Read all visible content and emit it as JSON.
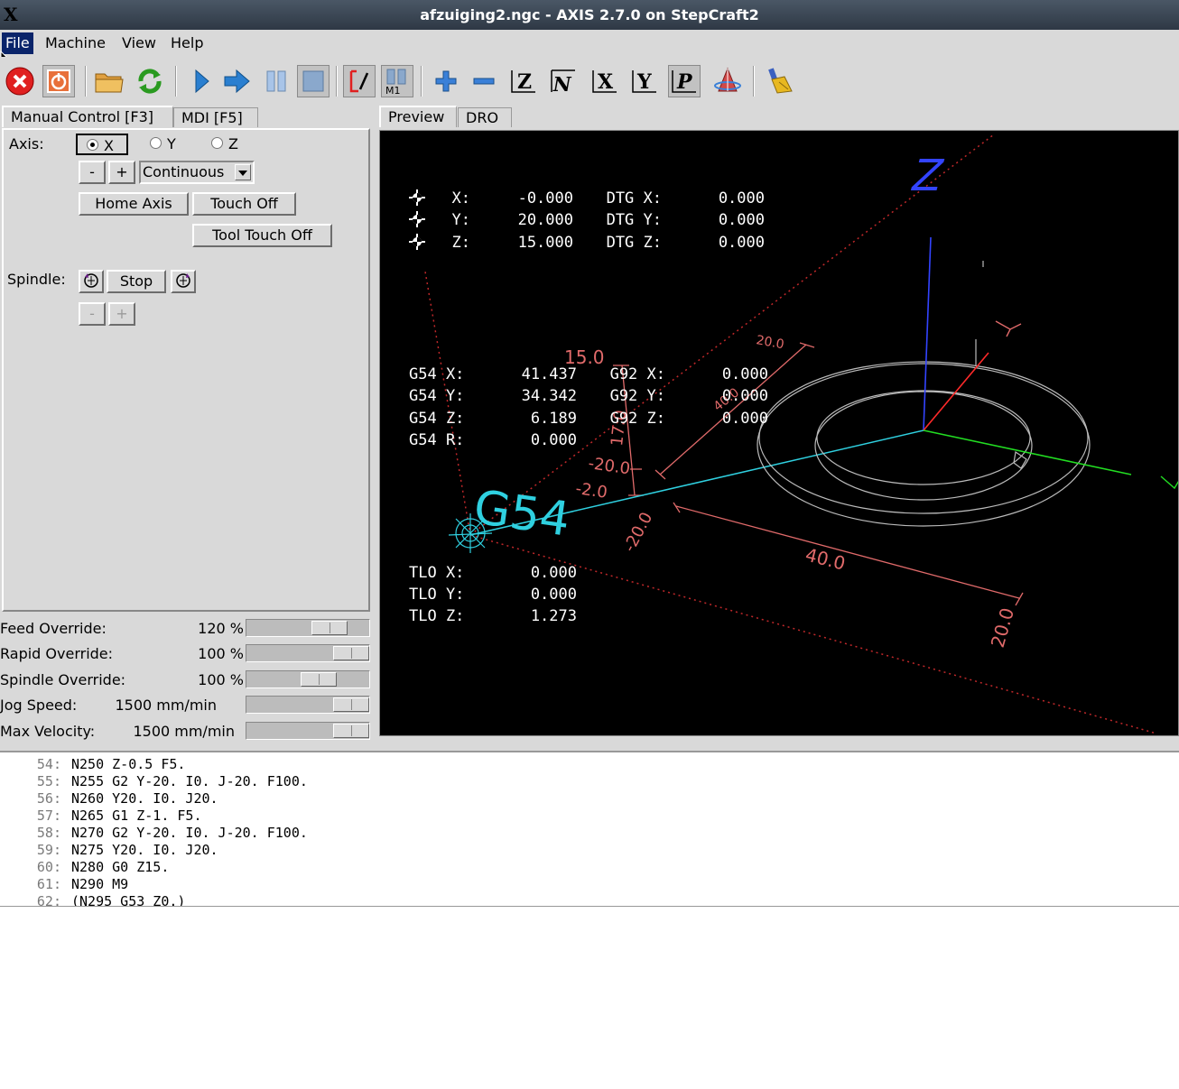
{
  "window": {
    "title": "afzuiging2.ngc - AXIS 2.7.0 on StepCraft2",
    "logo": "X"
  },
  "menu": [
    "File",
    "Machine",
    "View",
    "Help"
  ],
  "toolbar": [
    "estop-icon",
    "power-icon",
    "open-file-icon",
    "reload-icon",
    "run-icon",
    "step-icon",
    "pause-icon",
    "stop-icon",
    "block-delete-icon",
    "optional-stop-icon",
    "zoom-in-icon",
    "zoom-out-icon",
    "view-z-icon",
    "view-z2-icon",
    "view-x-icon",
    "view-y-icon",
    "view-p-icon",
    "rotate-icon",
    "clear-plot-icon"
  ],
  "left_tabs": [
    "Manual Control [F3]",
    "MDI [F5]"
  ],
  "manual": {
    "axis_label": "Axis:",
    "axes": [
      "X",
      "Y",
      "Z"
    ],
    "minus": "-",
    "plus": "+",
    "jog_mode": "Continuous",
    "home_axis": "Home Axis",
    "touch_off": "Touch Off",
    "tool_touch_off": "Tool Touch Off",
    "spindle_label": "Spindle:",
    "stop": "Stop"
  },
  "overrides": [
    {
      "name": "Feed Override:",
      "value": "120 %",
      "level": 0.75
    },
    {
      "name": "Rapid Override:",
      "value": "100 %",
      "level": 1.0
    },
    {
      "name": "Spindle Override:",
      "value": "100 %",
      "level": 0.62
    },
    {
      "name": "Jog Speed:",
      "value": "1500 mm/min",
      "level": 1.0
    },
    {
      "name": "Max Velocity:",
      "value": "1500 mm/min",
      "level": 1.0
    }
  ],
  "right_tabs": [
    "Preview",
    "DRO"
  ],
  "dro": {
    "pos": [
      {
        "axis": "X:",
        "value": "-0.000",
        "dtg_label": "DTG X:",
        "dtg": "0.000"
      },
      {
        "axis": "Y:",
        "value": "20.000",
        "dtg_label": "DTG Y:",
        "dtg": "0.000"
      },
      {
        "axis": "Z:",
        "value": "15.000",
        "dtg_label": "DTG Z:",
        "dtg": "0.000"
      }
    ],
    "g54": [
      {
        "label": "G54 X:",
        "value": "41.437",
        "g92_label": "G92 X:",
        "g92": "0.000"
      },
      {
        "label": "G54 Y:",
        "value": "34.342",
        "g92_label": "G92 Y:",
        "g92": "0.000"
      },
      {
        "label": "G54 Z:",
        "value": "6.189",
        "g92_label": "G92 Z:",
        "g92": "0.000"
      },
      {
        "label": "G54 R:",
        "value": "0.000"
      }
    ],
    "tlo": [
      {
        "label": "TLO X:",
        "value": "0.000"
      },
      {
        "label": "TLO Y:",
        "value": "0.000"
      },
      {
        "label": "TLO Z:",
        "value": "1.273"
      }
    ]
  },
  "preview_labels": {
    "g54": "G54",
    "z_axis": "Z",
    "y_axis": "Y",
    "dims": [
      "20.0",
      "40.0",
      "15.0",
      "17.0",
      "-20.0",
      "-2.0",
      "-20.0",
      "40.0",
      "20.0"
    ]
  },
  "colors": {
    "x_axis": "#ff2a2a",
    "y_axis": "#22dd22",
    "z_axis": "#3344ff",
    "dims": "#e06a6a",
    "feed": "#2fd0e0",
    "limit": "#c0282a",
    "origin": "#2fd0e0"
  },
  "code": [
    {
      "n": "54:",
      "text": "N250 Z-0.5 F5."
    },
    {
      "n": "55:",
      "text": "N255 G2 Y-20. I0. J-20. F100."
    },
    {
      "n": "56:",
      "text": "N260 Y20. I0. J20."
    },
    {
      "n": "57:",
      "text": "N265 G1 Z-1. F5."
    },
    {
      "n": "58:",
      "text": "N270 G2 Y-20. I0. J-20. F100."
    },
    {
      "n": "59:",
      "text": "N275 Y20. I0. J20."
    },
    {
      "n": "60:",
      "text": "N280 G0 Z15."
    },
    {
      "n": "61:",
      "text": "N290 M9"
    },
    {
      "n": "62:",
      "text": "(N295 G53 Z0.)"
    }
  ]
}
